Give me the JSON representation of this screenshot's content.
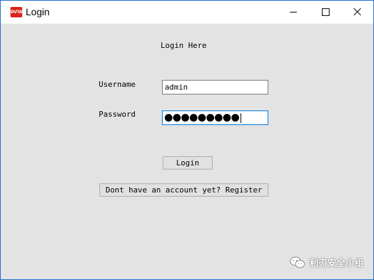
{
  "window": {
    "title": "Login",
    "app_icon_text": "DVTA",
    "app_icon_color": "#d7261e",
    "controls": {
      "minimize": "minimize-icon",
      "maximize": "maximize-icon",
      "close": "close-icon"
    }
  },
  "form": {
    "heading": "Login Here",
    "username_label": "Username",
    "username_value": "admin",
    "password_label": "Password",
    "password_masked_length": 9,
    "login_button": "Login",
    "register_button": "Dont have an account yet? Register"
  },
  "watermark": {
    "icon": "wechat-icon",
    "text": "利刃安全小组"
  }
}
